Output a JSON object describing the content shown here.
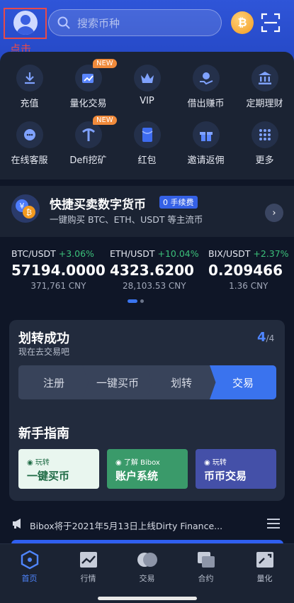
{
  "header": {
    "tap_label": "点击",
    "search_placeholder": "搜索币种",
    "coin_symbol": "₿"
  },
  "grid": [
    {
      "label": "充值",
      "icon": "deposit-icon",
      "new": false
    },
    {
      "label": "量化交易",
      "icon": "quant-trade-icon",
      "new": true
    },
    {
      "label": "VIP",
      "icon": "crown-icon",
      "new": false
    },
    {
      "label": "借出赚币",
      "icon": "lend-icon",
      "new": false
    },
    {
      "label": "定期理财",
      "icon": "bank-icon",
      "new": false
    },
    {
      "label": "在线客服",
      "icon": "support-icon",
      "new": false
    },
    {
      "label": "Defi挖矿",
      "icon": "mining-icon",
      "new": true
    },
    {
      "label": "红包",
      "icon": "red-packet-icon",
      "new": false
    },
    {
      "label": "邀请返佣",
      "icon": "gift-icon",
      "new": false
    },
    {
      "label": "更多",
      "icon": "more-icon",
      "new": false
    }
  ],
  "new_tag": "NEW",
  "quick_buy": {
    "title": "快捷买卖数字货币",
    "fee_badge": "0 手续费",
    "subtitle": "一键购买 BTC、ETH、USDT 等主流币"
  },
  "tickers": [
    {
      "pair": "BTC/USDT",
      "change": "+3.06%",
      "price": "57194.0000",
      "cny": "371,761 CNY"
    },
    {
      "pair": "ETH/USDT",
      "change": "+10.04%",
      "price": "4323.6200",
      "cny": "28,103.53 CNY"
    },
    {
      "pair": "BIX/USDT",
      "change": "+2.37%",
      "price": "0.209466",
      "cny": "1.36 CNY"
    }
  ],
  "onboarding": {
    "title": "划转成功",
    "subtitle": "现在去交易吧",
    "step_current": "4",
    "step_total": "/4",
    "steps": [
      "注册",
      "一键买币",
      "划转",
      "交易"
    ],
    "guide_title": "新手指南",
    "guide_cards": [
      {
        "small": "玩转",
        "big": "一键买币",
        "bg": "#e9f6ef",
        "fg": "#1f6b45"
      },
      {
        "small": "了解 Bibox",
        "big": "账户系统",
        "bg": "#3a9a6a",
        "fg": "#ffffff"
      },
      {
        "small": "玩转",
        "big": "币币交易",
        "bg": "#4450a8",
        "fg": "#ffffff"
      }
    ]
  },
  "news": {
    "text": "Bibox将于2021年5月13日上线Dirty Finance..."
  },
  "tabbar": [
    {
      "label": "首页",
      "icon": "home-icon",
      "active": true
    },
    {
      "label": "行情",
      "icon": "market-icon",
      "active": false
    },
    {
      "label": "交易",
      "icon": "trade-icon",
      "active": false
    },
    {
      "label": "合约",
      "icon": "contract-icon",
      "active": false
    },
    {
      "label": "量化",
      "icon": "quant-icon",
      "active": false
    }
  ],
  "colors": {
    "accent": "#3a73ee",
    "header_bg": "#2f55d8",
    "positive": "#3bc07a",
    "highlight_border": "#e74a4a"
  }
}
